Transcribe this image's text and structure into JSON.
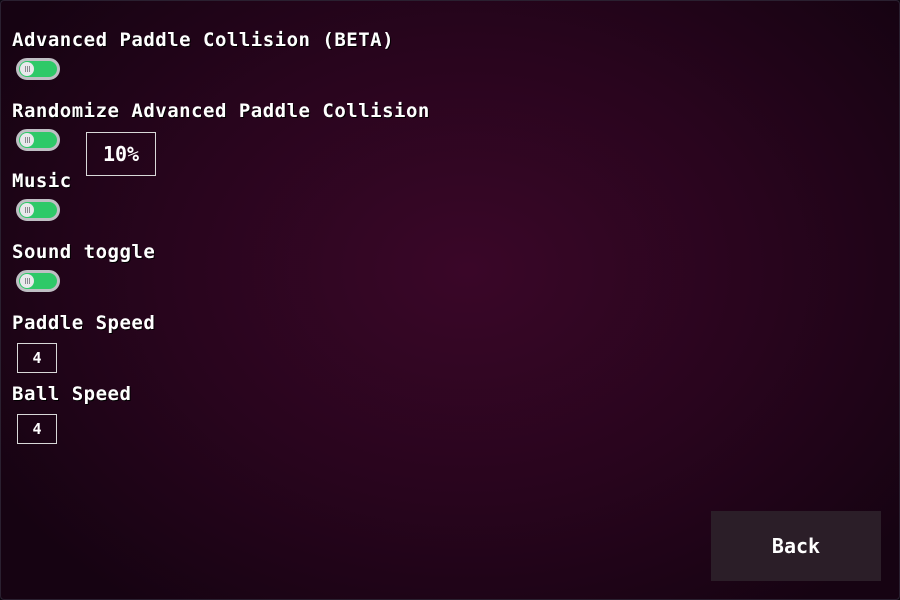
{
  "settings": {
    "advanced_collision": {
      "label": "Advanced Paddle Collision (BETA)",
      "enabled": true
    },
    "randomize_collision": {
      "label": "Randomize Advanced Paddle Collision",
      "enabled": true,
      "chance": "10%"
    },
    "music": {
      "label": "Music",
      "enabled": true
    },
    "sound": {
      "label": "Sound toggle",
      "enabled": true
    },
    "paddle_speed": {
      "label": "Paddle Speed",
      "value": "4"
    },
    "ball_speed": {
      "label": "Ball Speed",
      "value": "4"
    }
  },
  "back_button": {
    "label": "Back"
  },
  "colors": {
    "toggle_on": "#2ec968",
    "toggle_border": "#bfbfc4",
    "background_center": "#3a0628",
    "background_edge": "#160312",
    "button_bg": "#2b1e28"
  }
}
